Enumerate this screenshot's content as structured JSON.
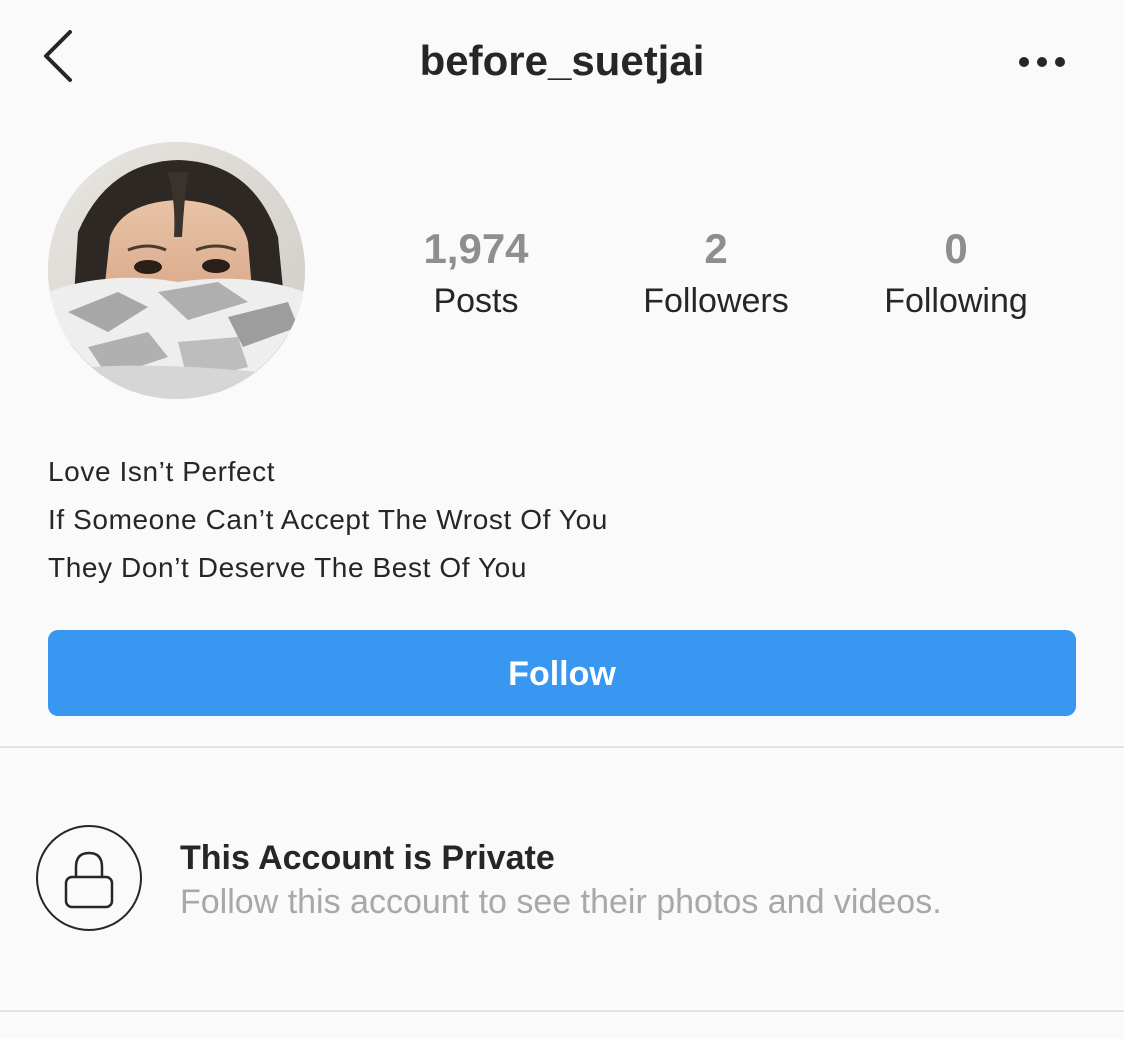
{
  "header": {
    "username": "before_suetjai",
    "back_icon": "chevron-left-icon",
    "more_icon": "more-horizontal-icon"
  },
  "profile": {
    "avatar": "profile-photo",
    "stats": [
      {
        "value": "1,974",
        "label": "Posts"
      },
      {
        "value": "2",
        "label": "Followers"
      },
      {
        "value": "0",
        "label": "Following"
      }
    ],
    "bio": [
      "Love Isn’t Perfect",
      "If Someone Can’t Accept The Wrost Of You",
      "They Don’t Deserve The Best Of You"
    ],
    "follow_label": "Follow"
  },
  "private_notice": {
    "icon": "lock-icon",
    "title": "This Account is Private",
    "subtitle": "Follow this account to see their photos and videos."
  },
  "colors": {
    "accent": "#3897f0",
    "text_primary": "#262626",
    "text_secondary": "#8e8e8e",
    "background": "#fafafa"
  }
}
